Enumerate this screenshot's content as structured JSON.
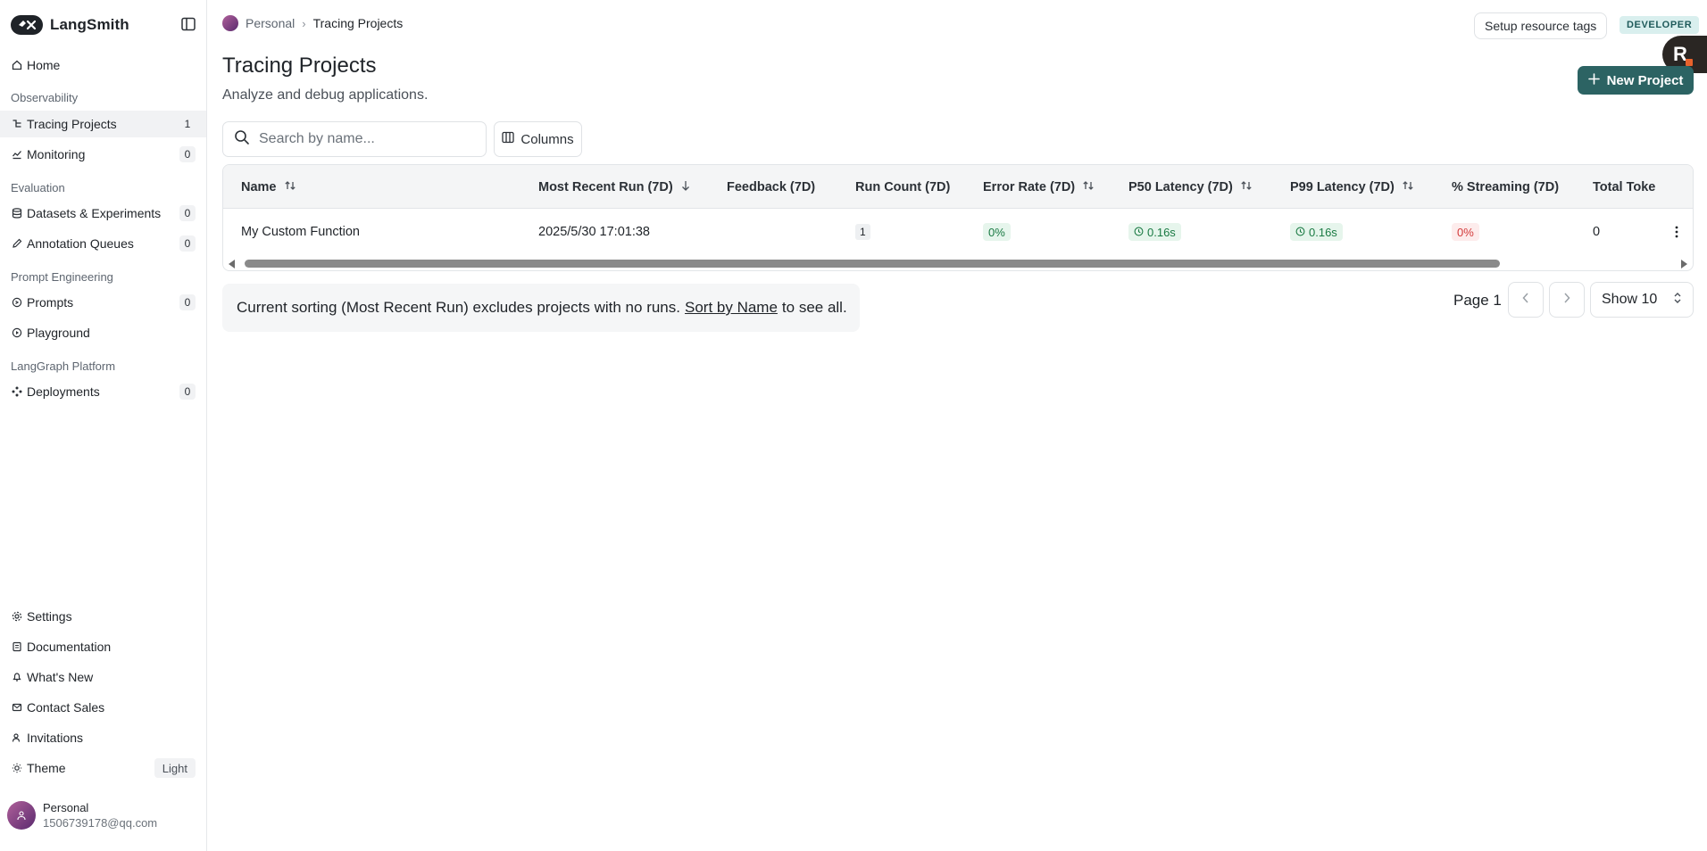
{
  "brand": {
    "name": "LangSmith"
  },
  "sidebar": {
    "home": "Home",
    "sections": {
      "observability": "Observability",
      "evaluation": "Evaluation",
      "prompt_engineering": "Prompt Engineering",
      "langgraph": "LangGraph Platform"
    },
    "items": {
      "tracing": {
        "label": "Tracing Projects",
        "count": "1"
      },
      "monitoring": {
        "label": "Monitoring",
        "count": "0"
      },
      "datasets": {
        "label": "Datasets & Experiments",
        "count": "0"
      },
      "annotation": {
        "label": "Annotation Queues",
        "count": "0"
      },
      "prompts": {
        "label": "Prompts",
        "count": "0"
      },
      "playground": {
        "label": "Playground"
      },
      "deployments": {
        "label": "Deployments",
        "count": "0"
      }
    },
    "bottom": {
      "settings": "Settings",
      "documentation": "Documentation",
      "whats_new": "What's New",
      "contact_sales": "Contact Sales",
      "invitations": "Invitations",
      "theme": "Theme",
      "theme_value": "Light"
    },
    "user": {
      "name": "Personal",
      "email": "1506739178@qq.com"
    }
  },
  "header": {
    "breadcrumb_root": "Personal",
    "breadcrumb_current": "Tracing Projects",
    "tags_button": "Setup resource tags",
    "badge": "DEVELOPER",
    "fab_letter": "R"
  },
  "main": {
    "title": "Tracing Projects",
    "subtitle": "Analyze and debug applications.",
    "new_button": "New Project",
    "search_placeholder": "Search by name...",
    "columns_button": "Columns"
  },
  "table": {
    "headers": {
      "name": "Name",
      "recent": "Most Recent Run (7D)",
      "feedback": "Feedback (7D)",
      "run_count": "Run Count (7D)",
      "error_rate": "Error Rate (7D)",
      "p50": "P50 Latency (7D)",
      "p99": "P99 Latency (7D)",
      "streaming": "% Streaming (7D)",
      "tokens": "Total Toke"
    },
    "rows": [
      {
        "name": "My Custom Function",
        "recent": "2025/5/30 17:01:38",
        "run_count": "1",
        "error_rate": "0%",
        "p50": "0.16s",
        "p99": "0.16s",
        "streaming": "0%",
        "tokens": "0"
      }
    ],
    "scroll_fraction": 0.88
  },
  "notice": {
    "before": "Current sorting (Most Recent Run) excludes projects with no runs.",
    "link": "Sort by Name",
    "after": "to see all."
  },
  "pagination": {
    "page_label": "Page 1",
    "show_label": "Show 10"
  }
}
